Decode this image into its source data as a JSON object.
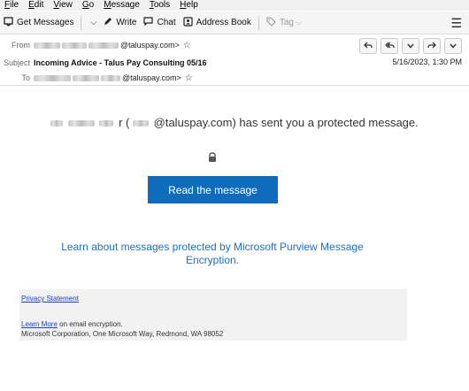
{
  "menubar": {
    "items": [
      "File",
      "Edit",
      "View",
      "Go",
      "Message",
      "Tools",
      "Help"
    ]
  },
  "toolbar": {
    "get_messages": "Get Messages",
    "write": "Write",
    "chat": "Chat",
    "address_book": "Address Book",
    "tag": "Tag"
  },
  "header": {
    "from_label": "From",
    "from_value": "@taluspay.com>",
    "subject_label": "Subject",
    "subject": "Incoming Advice - Talus Pay Consulting 05/16",
    "to_label": "To",
    "to_value": "@taluspay.com>",
    "datetime": "5/16/2023, 1:30 PM"
  },
  "message": {
    "sender_prefix": "r (",
    "sender_domain": "@taluspay.com) has sent you a protected message.",
    "read_button": "Read the message",
    "learn_link": "Learn about messages protected by Microsoft Purview Message Encryption.",
    "privacy": "Privacy Statement",
    "learn_more": "Learn More",
    "learn_more_suffix": " on email encryption.",
    "corp_address": "Microsoft Corporation, One Microsoft Way, Redmond, WA 98052"
  },
  "colors": {
    "button_blue": "#0f6cbd",
    "link_blue": "#1a6fc9",
    "footer_bg": "#f2f2f2"
  },
  "icons": [
    "get-messages-icon",
    "write-icon",
    "chat-icon",
    "address-book-icon",
    "tag-icon",
    "hamburger-icon",
    "star-icon",
    "reply-icon",
    "reply-all-icon",
    "forward-icon",
    "more-icon",
    "lock-icon"
  ]
}
